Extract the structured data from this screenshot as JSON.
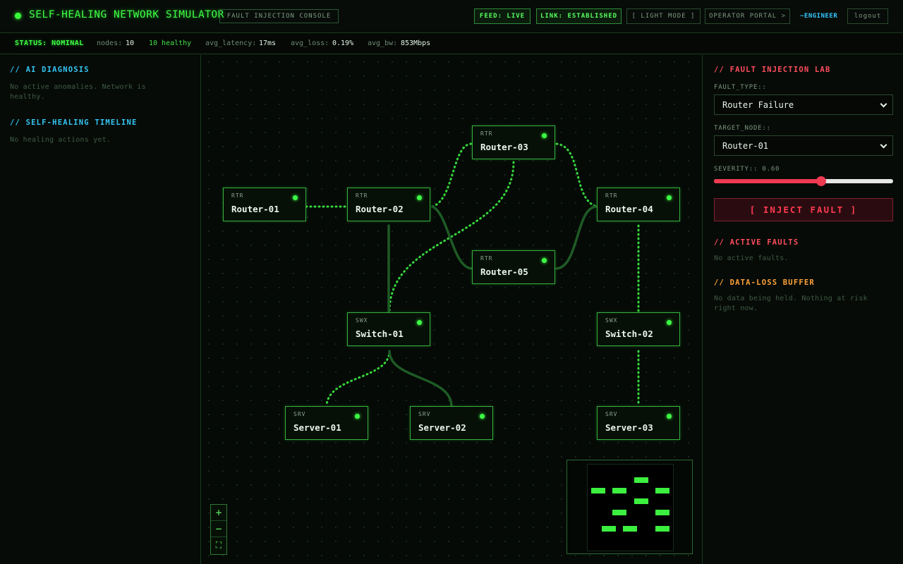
{
  "header": {
    "title": "SELF-HEALING NETWORK SIMULATOR",
    "console_tag": "FAULT INJECTION CONSOLE",
    "feed": "FEED: LIVE",
    "link": "LINK: ESTABLISHED",
    "light_mode": "[ LIGHT MODE ]",
    "operator_portal": "OPERATOR PORTAL >",
    "user": "~ENGINEER",
    "logout": "logout"
  },
  "statusbar": {
    "status": "STATUS: NOMINAL",
    "nodes_label": "nodes:",
    "nodes_value": "10",
    "healthy": "10 healthy",
    "latency_label": "avg_latency:",
    "latency_value": "17ms",
    "loss_label": "avg_loss:",
    "loss_value": "0.19%",
    "bw_label": "avg_bw:",
    "bw_value": "853Mbps"
  },
  "left": {
    "diagnosis_title": "// AI DIAGNOSIS",
    "diagnosis_text": "No active anomalies. Network is healthy.",
    "timeline_title": "// SELF-HEALING TIMELINE",
    "timeline_text": "No healing actions yet."
  },
  "right": {
    "lab_title": "// FAULT INJECTION LAB",
    "fault_type_label": "FAULT_TYPE::",
    "fault_type_value": "Router Failure",
    "target_label": "TARGET_NODE::",
    "target_value": "Router-01",
    "severity_label": "SEVERITY:: 0.60",
    "severity": 0.6,
    "inject_label": "[ INJECT FAULT ]",
    "active_title": "// ACTIVE FAULTS",
    "active_text": "No active faults.",
    "buffer_title": "// DATA-LOSS BUFFER",
    "buffer_text": "No data being held. Nothing at risk right now."
  },
  "topology": {
    "nodes": [
      {
        "id": "router-01",
        "type": "RTR",
        "name": "Router-01"
      },
      {
        "id": "router-02",
        "type": "RTR",
        "name": "Router-02"
      },
      {
        "id": "router-03",
        "type": "RTR",
        "name": "Router-03"
      },
      {
        "id": "router-04",
        "type": "RTR",
        "name": "Router-04"
      },
      {
        "id": "router-05",
        "type": "RTR",
        "name": "Router-05"
      },
      {
        "id": "switch-01",
        "type": "SWX",
        "name": "Switch-01"
      },
      {
        "id": "switch-02",
        "type": "SWX",
        "name": "Switch-02"
      },
      {
        "id": "server-01",
        "type": "SRV",
        "name": "Server-01"
      },
      {
        "id": "server-02",
        "type": "SRV",
        "name": "Server-02"
      },
      {
        "id": "server-03",
        "type": "SRV",
        "name": "Server-03"
      }
    ]
  },
  "zoom": {
    "in": "+",
    "out": "−",
    "fit": "⛶"
  },
  "colors": {
    "accent": "#3dff45",
    "cyan": "#34c6f4",
    "danger": "#ff3a50",
    "warn": "#ffa23a"
  }
}
